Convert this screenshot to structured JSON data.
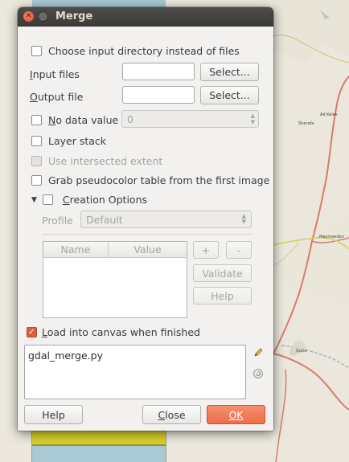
{
  "window": {
    "title": "Merge"
  },
  "options": {
    "choose_dir_label": "Choose input directory instead of files",
    "input_files_label": "Input files",
    "output_file_label": "Output file",
    "select_label": "Select...",
    "no_data_label": "No data value",
    "no_data_value": "0",
    "layer_stack_label": "Layer stack",
    "intersected_label": "Use intersected extent",
    "pseudocolor_label": "Grab pseudocolor table from the first image"
  },
  "creation": {
    "label": "Creation Options",
    "profile_label": "Profile",
    "profile_value": "Default",
    "columns": [
      "Name",
      "Value"
    ],
    "add_label": "+",
    "remove_label": "-",
    "validate_label": "Validate",
    "help_label": "Help"
  },
  "canvas": {
    "load_label": "Load into canvas when finished"
  },
  "command": {
    "text": "gdal_merge.py"
  },
  "footer": {
    "help_label": "Help",
    "close_label": "Close",
    "ok_label": "OK"
  },
  "map": {
    "labels": [
      "Ad Kelee",
      "Sherafa",
      "Maymeeden",
      "Quha"
    ]
  },
  "colors": {
    "accent": "#e9693f",
    "titlebar": "#3c3b37",
    "dialog_bg": "#f2f1f0"
  }
}
